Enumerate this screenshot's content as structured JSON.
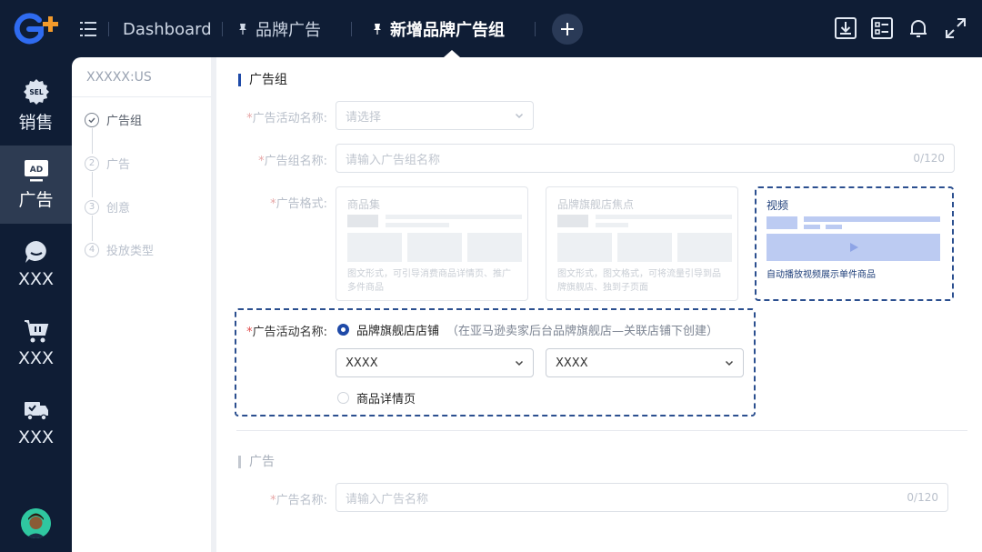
{
  "header": {
    "tabs": [
      {
        "label": "Dashboard"
      },
      {
        "label": "品牌广告"
      },
      {
        "label": "新增品牌广告组"
      }
    ]
  },
  "rail": {
    "items": [
      {
        "label": "销售",
        "badge": "SEL"
      },
      {
        "label": "广告",
        "badge": "AD"
      },
      {
        "label": "XXX"
      },
      {
        "label": "XXX"
      },
      {
        "label": "XXX"
      }
    ]
  },
  "steps": {
    "store": "XXXXX:US",
    "items": [
      {
        "num": "",
        "label": "广告组"
      },
      {
        "num": "2",
        "label": "广告"
      },
      {
        "num": "3",
        "label": "创意"
      },
      {
        "num": "4",
        "label": "投放类型"
      }
    ]
  },
  "form": {
    "section_title": "广告组",
    "campaign_label": "广告活动名称:",
    "campaign_placeholder": "请选择",
    "group_name_label": "广告组名称:",
    "group_name_placeholder": "请输入广告组名称",
    "group_name_counter": "0/120",
    "format_label": "广告格式:",
    "formats": [
      {
        "title": "商品集",
        "desc": "图文形式，可引导消费商品详情页、推广多件商品"
      },
      {
        "title": "品牌旗舰店焦点",
        "desc": "图文形式，图文格式，可将流量引导到品牌旗舰店、独到子页面"
      },
      {
        "title": "视频",
        "desc": "自动播放视频展示单件商品"
      }
    ],
    "landing_label": "广告活动名称:",
    "landing_option_store": "品牌旗舰店店铺",
    "landing_option_store_hint": "（在亚马逊卖家后台品牌旗舰店—关联店铺下创建）",
    "store_select_1": "XXXX",
    "store_select_2": "XXXX",
    "landing_option_detail": "商品详情页"
  },
  "ad": {
    "section_title": "广告",
    "name_label": "广告名称:",
    "name_placeholder": "请输入广告名称",
    "name_counter": "0/120"
  },
  "colors": {
    "sidebar_bg": "#0f1d35",
    "accent": "#1f4aa8",
    "highlight_dash": "#2b4f8f",
    "logo_blue": "#2f6bf0",
    "logo_orange": "#f39a2b"
  }
}
